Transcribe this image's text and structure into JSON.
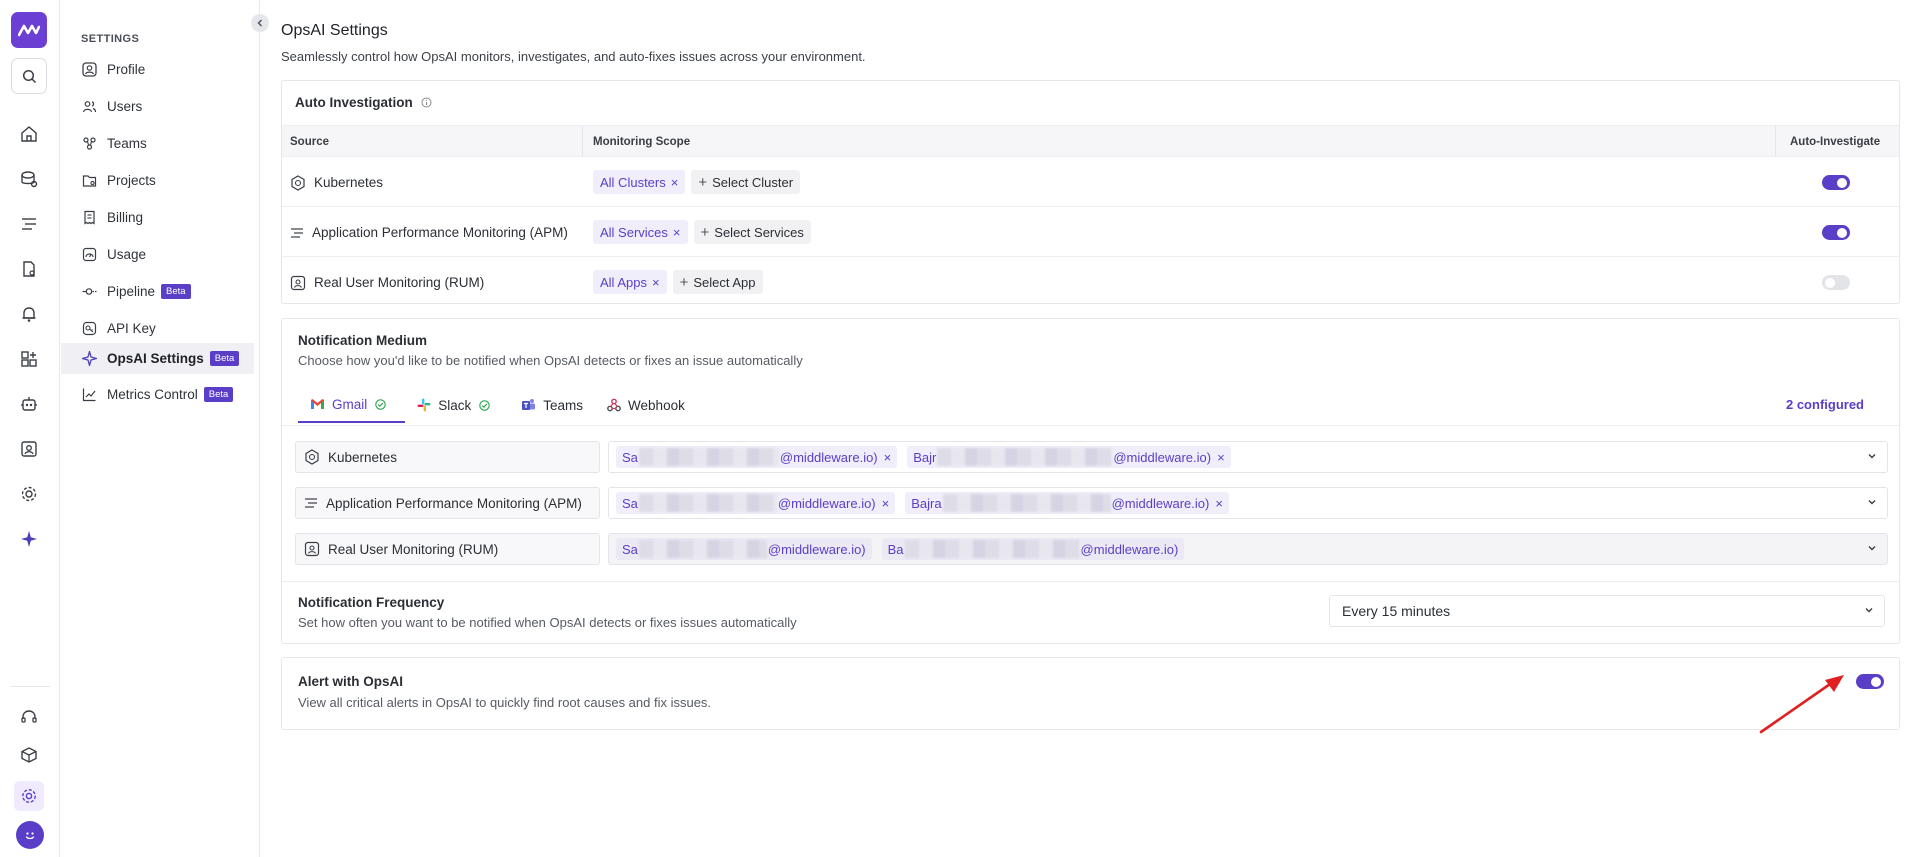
{
  "settings_header": "SETTINGS",
  "sidebar": {
    "items": [
      {
        "label": "Profile",
        "icon": "user-circle-icon"
      },
      {
        "label": "Users",
        "icon": "users-icon"
      },
      {
        "label": "Teams",
        "icon": "teams-icon"
      },
      {
        "label": "Projects",
        "icon": "folder-icon"
      },
      {
        "label": "Billing",
        "icon": "receipt-icon"
      },
      {
        "label": "Usage",
        "icon": "gauge-icon"
      },
      {
        "label": "Pipeline",
        "icon": "pipeline-icon",
        "badge": "Beta"
      },
      {
        "label": "API Key",
        "icon": "key-icon"
      },
      {
        "label": "OpsAI Settings",
        "icon": "sparkle-icon",
        "badge": "Beta",
        "active": true
      },
      {
        "label": "Metrics Control",
        "icon": "chart-icon",
        "badge": "Beta"
      }
    ]
  },
  "page": {
    "title": "OpsAI Settings",
    "subtitle": "Seamlessly control how OpsAI monitors, investigates, and auto-fixes issues across your environment."
  },
  "auto_investigation": {
    "title": "Auto Investigation",
    "columns": {
      "source": "Source",
      "scope": "Monitoring Scope",
      "auto": "Auto-Investigate"
    },
    "rows": [
      {
        "source": "Kubernetes",
        "chip": "All Clusters",
        "add": "Select Cluster",
        "enabled": true
      },
      {
        "source": "Application Performance Monitoring (APM)",
        "chip": "All Services",
        "add": "Select Services",
        "enabled": true
      },
      {
        "source": "Real User Monitoring (RUM)",
        "chip": "All Apps",
        "add": "Select App",
        "enabled": false
      }
    ]
  },
  "notification_medium": {
    "title": "Notification Medium",
    "description": "Choose how you'd like to be notified when OpsAI detects or fixes an issue automatically",
    "tabs": [
      {
        "label": "Gmail",
        "checked": true,
        "active": true
      },
      {
        "label": "Slack",
        "checked": true
      },
      {
        "label": "Teams"
      },
      {
        "label": "Webhook"
      }
    ],
    "configured": "2 configured",
    "rows": [
      {
        "label": "Kubernetes",
        "emails": [
          {
            "pre": "Sa",
            "post": "@middleware.io)"
          },
          {
            "pre": "Bajr",
            "post": "@middleware.io)"
          }
        ]
      },
      {
        "label": "Application Performance Monitoring (APM)",
        "emails": [
          {
            "pre": "Sa",
            "post": "@middleware.io)"
          },
          {
            "pre": "Bajra",
            "post": "@middleware.io)"
          }
        ]
      },
      {
        "label": "Real User Monitoring (RUM)",
        "emails": [
          {
            "pre": "Sa",
            "post": "@middleware.io)"
          },
          {
            "pre": "Ba",
            "post": "@middleware.io)"
          }
        ]
      }
    ]
  },
  "notification_frequency": {
    "title": "Notification Frequency",
    "description": "Set how often you want to be notified when OpsAI detects or fixes issues automatically",
    "value": "Every 15 minutes"
  },
  "alert_opsai": {
    "title": "Alert with OpsAI",
    "description": "View all critical alerts in OpsAI to quickly find root causes and fix issues.",
    "enabled": true
  },
  "colors": {
    "accent": "#5b3ec8",
    "annotation_arrow": "#e02020"
  }
}
